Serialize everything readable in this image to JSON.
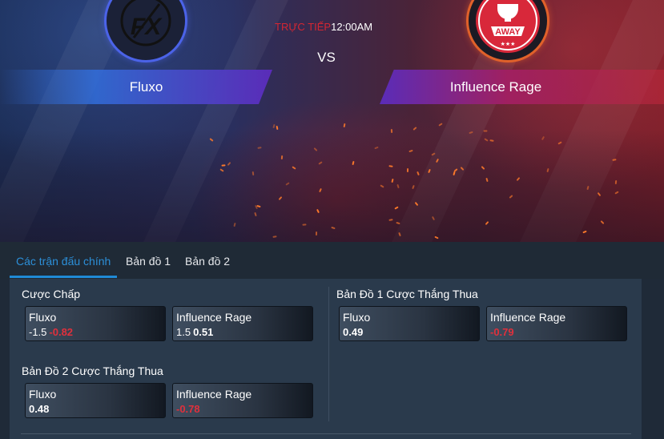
{
  "match": {
    "status_label": "TRỰC TIẾP",
    "time": "12:00AM",
    "vs_label": "VS",
    "home": {
      "name": "Fluxo",
      "logo_icon": "fx-logo-icon",
      "logo_text": "FX",
      "ring_color": "#4b63e8"
    },
    "away": {
      "name": "Influence Rage",
      "logo_icon": "away-crest-icon",
      "logo_text": "AWAY",
      "ring_color": "#e0612a"
    }
  },
  "tabs": [
    {
      "label": "Các trận đấu chính",
      "active": true
    },
    {
      "label": "Bản đồ 1",
      "active": false
    },
    {
      "label": "Bản đồ 2",
      "active": false
    }
  ],
  "markets": [
    {
      "title": "Cược Chấp",
      "odds": [
        {
          "team": "Fluxo",
          "handicap": "-1.5",
          "value": "-0.82"
        },
        {
          "team": "Influence Rage",
          "handicap": "1.5",
          "value": "0.51"
        }
      ]
    },
    {
      "title": "Bản Đồ 1 Cược Thắng Thua",
      "odds": [
        {
          "team": "Fluxo",
          "handicap": "",
          "value": "0.49"
        },
        {
          "team": "Influence Rage",
          "handicap": "",
          "value": "-0.79"
        }
      ]
    },
    {
      "title": "Bản Đồ 2 Cược Thắng Thua",
      "odds": [
        {
          "team": "Fluxo",
          "handicap": "",
          "value": "0.48"
        },
        {
          "team": "Influence Rage",
          "handicap": "",
          "value": "-0.78"
        }
      ]
    }
  ],
  "colors": {
    "live": "#d42632",
    "active_tab": "#2c8fd8",
    "negative_odds": "#e0303c",
    "panel": "#2a3a4c"
  }
}
